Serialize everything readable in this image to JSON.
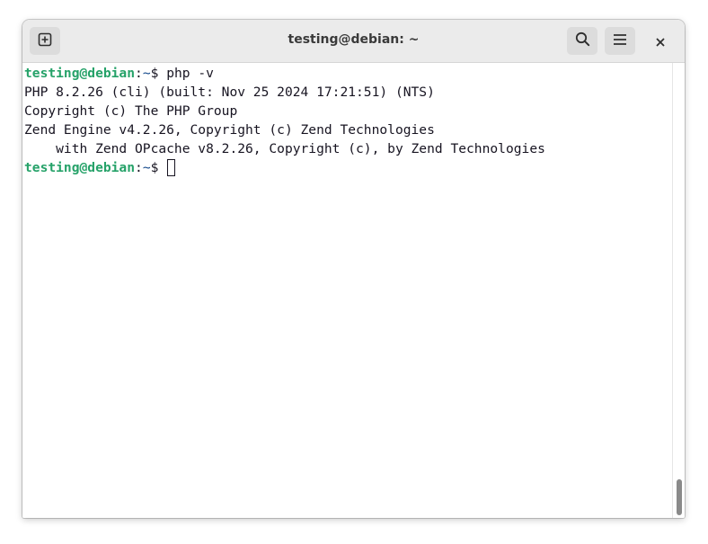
{
  "window": {
    "title": "testing@debian: ~"
  },
  "headerbar": {
    "new_tab_icon": "plus-square-icon",
    "search_icon": "search-icon",
    "menu_icon": "hamburger-menu-icon",
    "close_icon": "close-icon"
  },
  "terminal": {
    "prompt_user": "testing@debian",
    "prompt_colon": ":",
    "prompt_path": "~",
    "prompt_symbol": "$ ",
    "command": "php -v",
    "output": [
      "PHP 8.2.26 (cli) (built: Nov 25 2024 17:21:51) (NTS)",
      "Copyright (c) The PHP Group",
      "Zend Engine v4.2.26, Copyright (c) Zend Technologies",
      "    with Zend OPcache v8.2.26, Copyright (c), by Zend Technologies"
    ],
    "second_prompt_user": "testing@debian",
    "second_prompt_colon": ":",
    "second_prompt_path": "~",
    "second_prompt_symbol": "$ "
  },
  "colors": {
    "prompt_user": "#26a269",
    "prompt_path": "#12488b",
    "text": "#171421",
    "headerbar_bg": "#ebebeb"
  }
}
